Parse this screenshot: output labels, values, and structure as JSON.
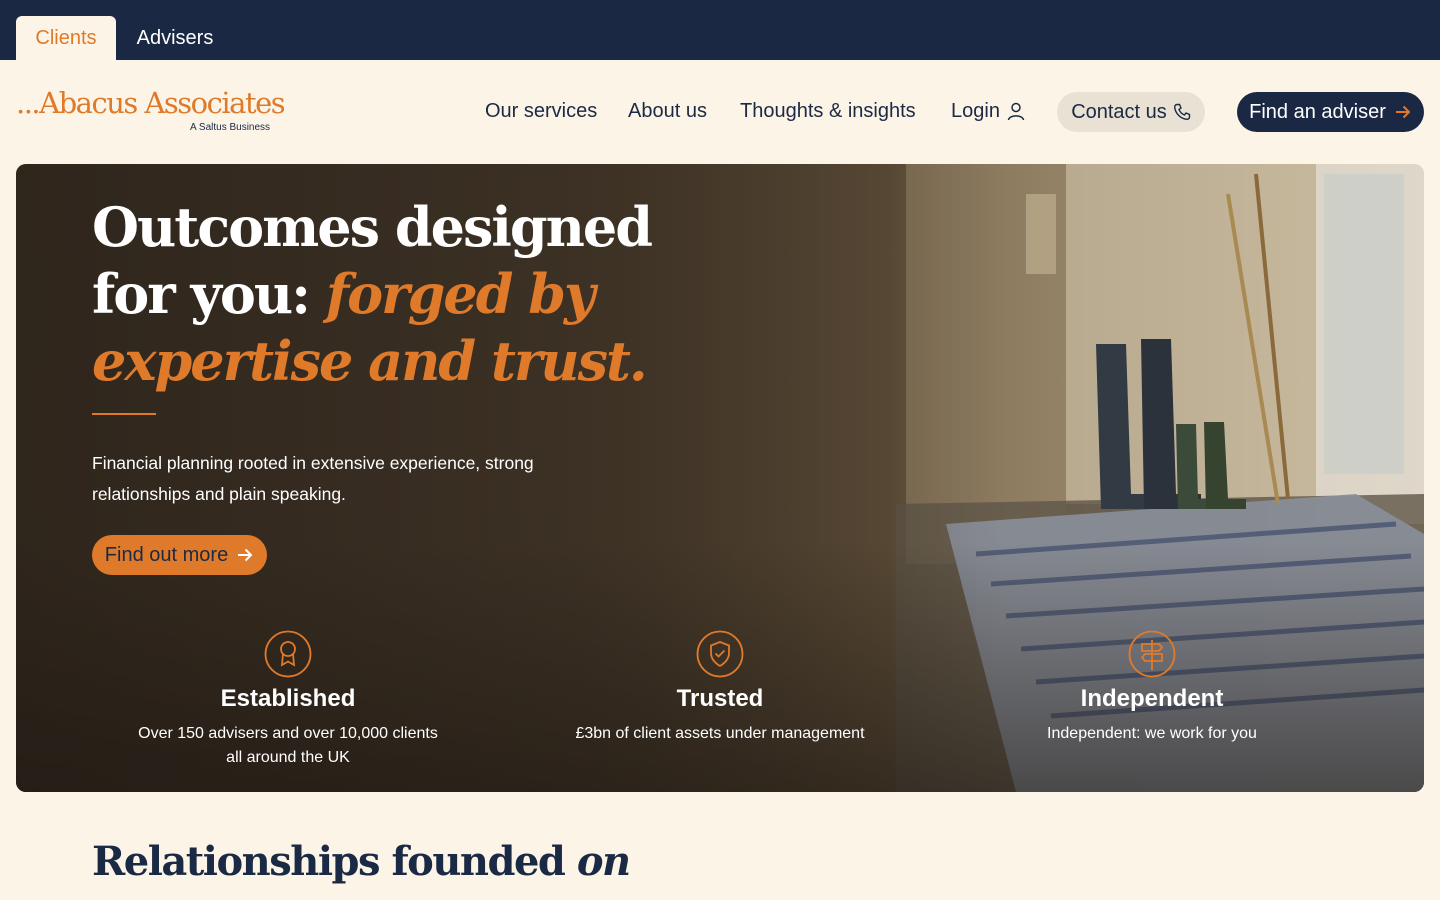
{
  "audience_tabs": [
    {
      "label": "Clients",
      "active": true
    },
    {
      "label": "Advisers",
      "active": false
    }
  ],
  "brand": {
    "name": "...Abacus Associates",
    "tagline": "A Saltus Business",
    "accent_color": "#e07a2b",
    "navy_color": "#1b2844"
  },
  "nav": {
    "services": "Our services",
    "about": "About us",
    "thoughts": "Thoughts & insights",
    "login": "Login",
    "contact": "Contact us",
    "find_adviser": "Find an adviser"
  },
  "hero": {
    "title_plain": "Outcomes designed for you: ",
    "title_accent": "forged by expertise and trust.",
    "description": "Financial planning rooted in extensive experience, strong relationships and plain speaking.",
    "cta": "Find out more"
  },
  "features": [
    {
      "icon": "award-ribbon-icon",
      "title": "Established",
      "text": "Over 150 advisers and over 10,000 clients all around the UK"
    },
    {
      "icon": "shield-check-icon",
      "title": "Trusted",
      "text": "£3bn of client assets under management"
    },
    {
      "icon": "signpost-icon",
      "title": "Independent",
      "text": "Independent: we work for you"
    }
  ],
  "section": {
    "heading_plain": "Relationships founded ",
    "heading_italic": "on"
  }
}
